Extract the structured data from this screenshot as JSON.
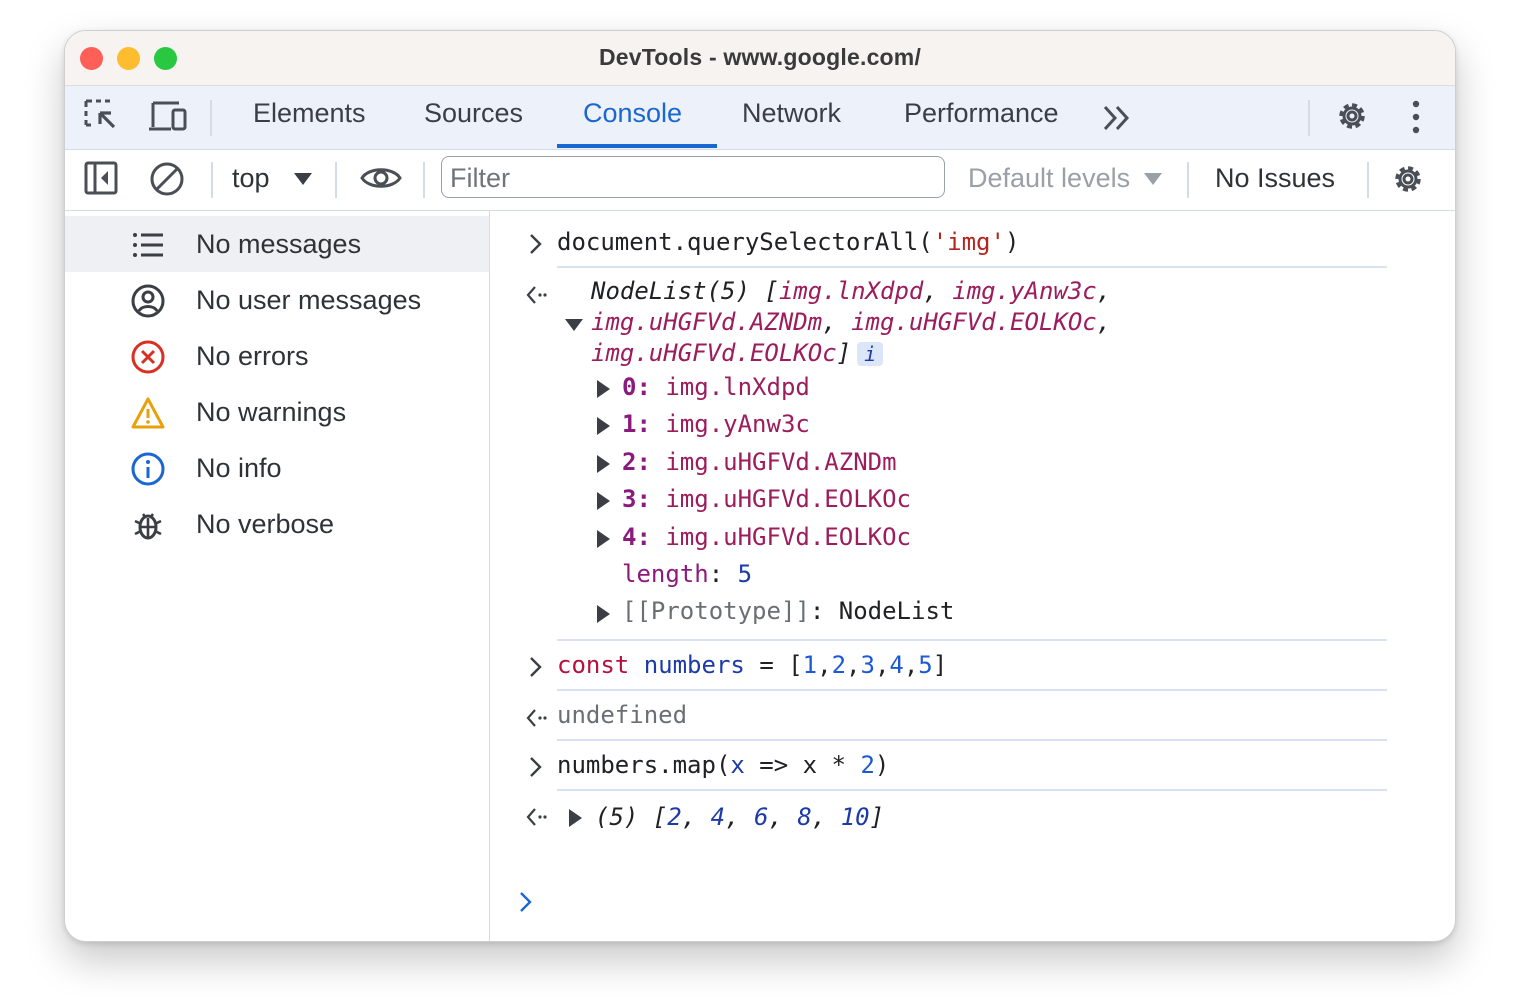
{
  "window": {
    "title": "DevTools - www.google.com/"
  },
  "colors": {
    "accent": "#1a67d2",
    "traffic_close": "#ff5f57",
    "traffic_min": "#febc2e",
    "traffic_max": "#28c840"
  },
  "tabs": [
    {
      "label": "Elements"
    },
    {
      "label": "Sources"
    },
    {
      "label": "Console",
      "active": true
    },
    {
      "label": "Network"
    },
    {
      "label": "Performance"
    }
  ],
  "tabbar_icons": [
    "inspect-element-icon",
    "device-toolbar-icon",
    "more-tabs-icon",
    "settings-icon",
    "kebab-menu-icon"
  ],
  "toolbar": {
    "context": "top",
    "filter_placeholder": "Filter",
    "levels": "Default levels",
    "issues": "No Issues"
  },
  "sidebar": {
    "items": [
      {
        "label": "No messages",
        "icon": "list-icon"
      },
      {
        "label": "No user messages",
        "icon": "user-icon"
      },
      {
        "label": "No errors",
        "icon": "error-icon"
      },
      {
        "label": "No warnings",
        "icon": "warning-icon"
      },
      {
        "label": "No info",
        "icon": "info-icon"
      },
      {
        "label": "No verbose",
        "icon": "bug-icon"
      }
    ]
  },
  "console": {
    "cmd1": {
      "fn": "document.querySelectorAll(",
      "arg": "'img'",
      "close": ")"
    },
    "result1": {
      "head": "NodeList(5) [",
      "items": [
        "img.lnXdpd",
        "img.yAnw3c",
        "img.uHGFVd.AZNDm",
        "img.uHGFVd.EOLKOc",
        "img.uHGFVd.EOLKOc"
      ],
      "badge": "i",
      "entries": [
        {
          "key": "0",
          "value": "img.lnXdpd"
        },
        {
          "key": "1",
          "value": "img.yAnw3c"
        },
        {
          "key": "2",
          "value": "img.uHGFVd.AZNDm"
        },
        {
          "key": "3",
          "value": "img.uHGFVd.EOLKOc"
        },
        {
          "key": "4",
          "value": "img.uHGFVd.EOLKOc"
        }
      ],
      "length_key": "length",
      "length_value": "5",
      "proto_key": "[[Prototype]]",
      "proto_value": "NodeList"
    },
    "cmd2": {
      "kw": "const",
      "name": "numbers",
      "op": "=",
      "values": [
        "1",
        "2",
        "3",
        "4",
        "5"
      ]
    },
    "result2": "undefined",
    "cmd3": {
      "obj": "numbers.map(",
      "param": "x",
      "arrow": "=>",
      "body": "x * ",
      "num": "2",
      "close": ")"
    },
    "result3": {
      "count": "(5)",
      "values": [
        "2",
        "4",
        "6",
        "8",
        "10"
      ]
    }
  }
}
